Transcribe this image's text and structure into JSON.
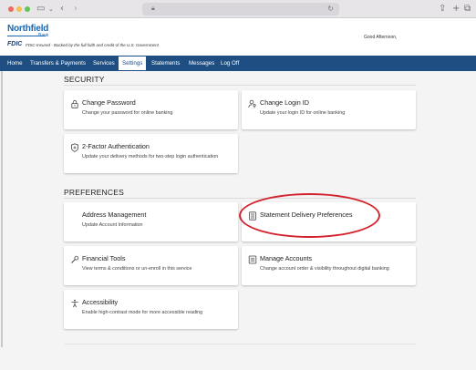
{
  "header": {
    "logo_name": "Northfield",
    "logo_sub": "Bank",
    "fdic_label": "FDIC",
    "fdic_text": "FDIC-Insured - Backed by the full faith and credit of the U.S. Government",
    "greeting": "Good Afternoon,"
  },
  "nav": {
    "items": [
      {
        "label": "Home"
      },
      {
        "label": "Transfers & Payments"
      },
      {
        "label": "Services"
      },
      {
        "label": "Settings"
      },
      {
        "label": "Statements"
      },
      {
        "label": "Messages"
      },
      {
        "label": "Log Off"
      }
    ],
    "active": "Settings"
  },
  "security": {
    "title": "SECURITY",
    "cards": [
      {
        "title": "Change Password",
        "desc": "Change your password for online banking",
        "icon": "lock-icon"
      },
      {
        "title": "Change Login ID",
        "desc": "Update your login ID for online banking",
        "icon": "user-key-icon"
      },
      {
        "title": "2-Factor Authentication",
        "desc": "Update your delivery methods for two-step login authentication",
        "icon": "shield-icon"
      }
    ]
  },
  "preferences": {
    "title": "PREFERENCES",
    "cards": [
      {
        "title": "Address Management",
        "desc": "Update Account Information",
        "icon": ""
      },
      {
        "title": "Statement Delivery Preferences",
        "desc": "",
        "icon": "document-icon"
      },
      {
        "title": "Financial Tools",
        "desc": "View terms & conditions or un-enroll in this service",
        "icon": "tools-icon"
      },
      {
        "title": "Manage Accounts",
        "desc": "Change account order & visibility throughout digital banking",
        "icon": "list-icon"
      },
      {
        "title": "Accessibility",
        "desc": "Enable high-contrast mode for more accessible reading",
        "icon": "accessibility-icon"
      }
    ]
  },
  "colors": {
    "nav_bg": "#1f4f82",
    "brand_blue": "#1b66b1",
    "highlight_red": "#d3232f"
  }
}
